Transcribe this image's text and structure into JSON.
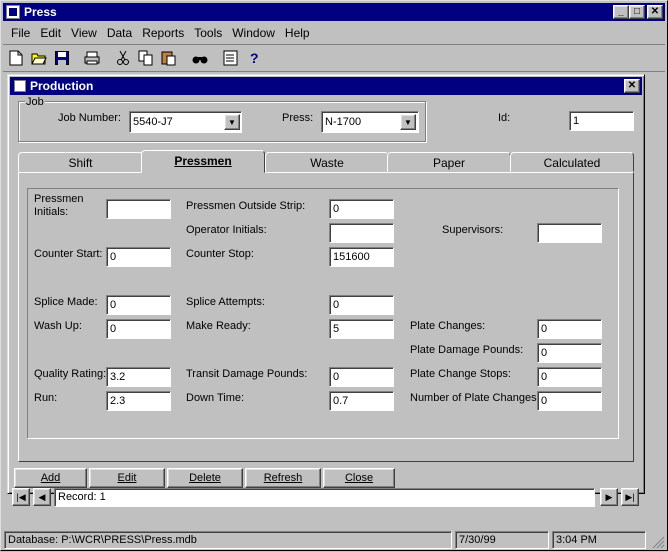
{
  "app": {
    "title": "Press",
    "menu": [
      "File",
      "Edit",
      "View",
      "Data",
      "Reports",
      "Tools",
      "Window",
      "Help"
    ]
  },
  "child": {
    "title": "Production"
  },
  "job": {
    "group_label": "Job",
    "job_number_label": "Job Number:",
    "job_number_value": "5540-J7",
    "press_label": "Press:",
    "press_value": "N-1700",
    "id_label": "Id:",
    "id_value": "1"
  },
  "tabs": [
    "Shift",
    "Pressmen",
    "Waste",
    "Paper",
    "Calculated"
  ],
  "form": {
    "pressmen_initials_label": "Pressmen Initials:",
    "pressmen_initials_value": "",
    "outside_strip_label": "Pressmen Outside Strip:",
    "outside_strip_value": "0",
    "operator_initials_label": "Operator Initials:",
    "operator_initials_value": "",
    "supervisors_label": "Supervisors:",
    "supervisors_value": "",
    "counter_start_label": "Counter Start:",
    "counter_start_value": "0",
    "counter_stop_label": "Counter Stop:",
    "counter_stop_value": "151600",
    "splice_made_label": "Splice Made:",
    "splice_made_value": "0",
    "splice_attempts_label": "Splice Attempts:",
    "splice_attempts_value": "0",
    "wash_up_label": "Wash Up:",
    "wash_up_value": "0",
    "make_ready_label": "Make Ready:",
    "make_ready_value": "5",
    "plate_changes_label": "Plate Changes:",
    "plate_changes_value": "0",
    "plate_damage_label": "Plate Damage Pounds:",
    "plate_damage_value": "0",
    "quality_rating_label": "Quality Rating:",
    "quality_rating_value": "3.2",
    "transit_damage_label": "Transit Damage Pounds:",
    "transit_damage_value": "0",
    "plate_change_stops_label": "Plate Change Stops:",
    "plate_change_stops_value": "0",
    "run_label": "Run:",
    "run_value": "2.3",
    "down_time_label": "Down Time:",
    "down_time_value": "0.7",
    "num_plate_changes_label": "Number of Plate Changes:",
    "num_plate_changes_value": "0"
  },
  "buttons": {
    "add": "Add",
    "edit": "Edit",
    "delete": "Delete",
    "refresh": "Refresh",
    "close": "Close"
  },
  "navigator": {
    "record_text": "Record: 1"
  },
  "status": {
    "database": "Database:  P:\\WCR\\PRESS\\Press.mdb",
    "date": "7/30/99",
    "time": "3:04 PM"
  },
  "icons": [
    "app-icon",
    "new-icon",
    "open-icon",
    "save-icon",
    "print-icon",
    "cut-icon",
    "copy-icon",
    "paste-icon",
    "find-icon",
    "properties-icon",
    "help-icon"
  ],
  "colors": {
    "titlebar": "#000080",
    "face": "#c0c0c0"
  }
}
